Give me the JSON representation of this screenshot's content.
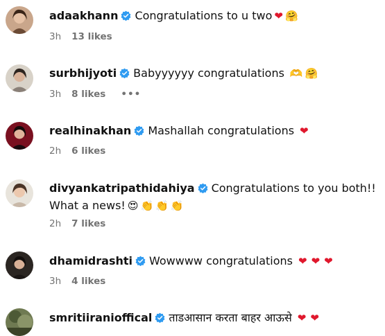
{
  "comments": [
    {
      "username": "adaakhann",
      "text": "Congratulations to u two",
      "emojis": [
        "❤",
        "🤗"
      ],
      "time": "3h",
      "likes": "13 likes",
      "show_more": false
    },
    {
      "username": "surbhijyoti",
      "text": "Babyyyyyy congratulations",
      "emojis": [
        "🫶",
        "🤗"
      ],
      "time": "3h",
      "likes": "8 likes",
      "more_label": "•••"
    },
    {
      "username": "realhinakhan",
      "text": "Mashallah congratulations",
      "emojis": [
        "❤"
      ],
      "time": "2h",
      "likes": "6 likes"
    },
    {
      "username": "divyankatripathidahiya",
      "text": "Congratulations to you both!! What a news!",
      "emojis": [
        "😍",
        "👏",
        "👏",
        "👏"
      ],
      "time": "2h",
      "likes": "7 likes"
    },
    {
      "username": "dhamidrashti",
      "text": "Wowwww congratulations",
      "emojis": [
        "❤",
        "❤",
        "❤"
      ],
      "time": "3h",
      "likes": "4 likes"
    },
    {
      "username": "smritiiranioffical",
      "text": "ताडआसान करता बाहर आऊसे",
      "emojis": [
        "❤",
        "❤"
      ]
    }
  ],
  "colors": {
    "verified": "#2f9bf1",
    "heart": "#e0182d",
    "meta": "#737373"
  },
  "icons": {
    "verified": "verified-badge-icon",
    "more": "more-options-icon"
  }
}
